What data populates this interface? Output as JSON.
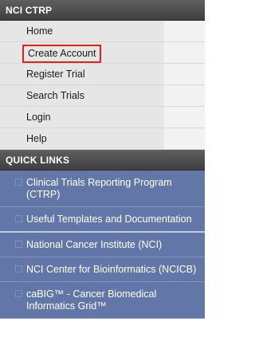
{
  "nci_ctrp": {
    "title": "NCI CTRP",
    "items": [
      {
        "label": "Home"
      },
      {
        "label": "Create Account"
      },
      {
        "label": "Register Trial"
      },
      {
        "label": "Search Trials"
      },
      {
        "label": "Login"
      },
      {
        "label": "Help"
      }
    ],
    "highlighted_item": "Create Account",
    "highlight_color": "#e2231a"
  },
  "quick_links": {
    "title": "QUICK LINKS",
    "items": [
      {
        "label": "Clinical Trials Reporting Program (CTRP)"
      },
      {
        "label": "Useful Templates and Documentation"
      },
      {
        "label": "National Cancer Institute (NCI)"
      },
      {
        "label": "NCI Center for Bioinformatics (NCICB)"
      },
      {
        "label": "caBIG™ - Cancer Biomedical Informatics Grid™"
      }
    ],
    "background_color": "#6276a8"
  },
  "colors": {
    "header_bg": "#4a4a4a",
    "nav_bg": "#e6e6e6"
  }
}
